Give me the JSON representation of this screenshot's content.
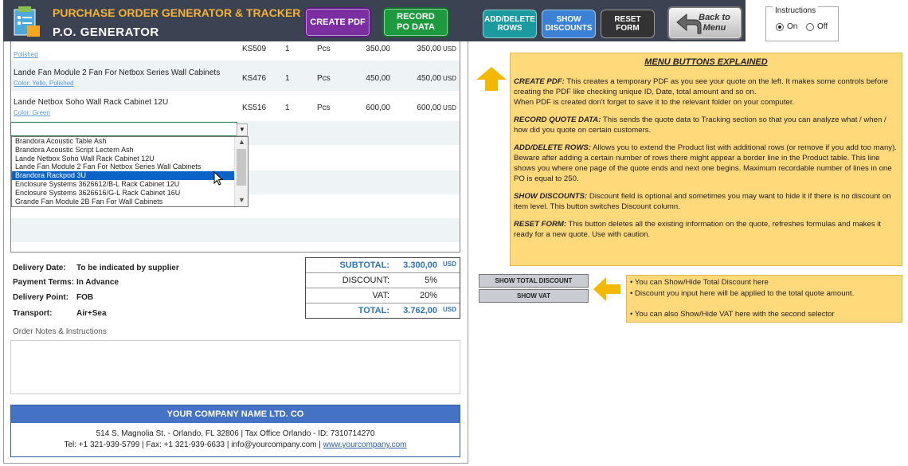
{
  "header": {
    "title": "PURCHASE ORDER GENERATOR & TRACKER",
    "subtitle": "P.O. GENERATOR",
    "buttons": {
      "create_pdf": "CREATE PDF",
      "record": "RECORD PO DATA",
      "add_delete": "ADD/DELETE ROWS",
      "show_discounts": "SHOW DISCOUNTS",
      "reset": "RESET FORM",
      "back": "Back to Menu"
    }
  },
  "instructions": {
    "title": "Instructions",
    "on": "On",
    "off": "Off",
    "selected": "On"
  },
  "products": [
    {
      "name": "",
      "color": "Polished",
      "code": "KS509",
      "qty": "1",
      "unit": "Pcs",
      "price": "350,00",
      "total": "350,00",
      "currency": "USD"
    },
    {
      "name": "Lande Fan Module 2 Fan For Netbox Series Wall Cabinets",
      "color": "Color: Yello, Polished",
      "code": "KS476",
      "qty": "1",
      "unit": "Pcs",
      "price": "450,00",
      "total": "450,00",
      "currency": "USD"
    },
    {
      "name": "Lande Netbox Soho Wall Rack Cabinet 12U",
      "color": "Color: Green",
      "code": "KS516",
      "qty": "1",
      "unit": "Pcs",
      "price": "600,00",
      "total": "600,00",
      "currency": "USD"
    }
  ],
  "dropdown": {
    "items": [
      "Brandora Acoustic Table Ash",
      "Brandora Acoustic Script Lectern Ash",
      "Lande Netbox Soho Wall Rack Cabinet 12U",
      "Lande Fan Module 2 Fan For Netbox Series Wall Cabinets",
      "Brandora Rackpod 3U",
      "Enclosure Systems 3626612/B-L Rack Cabinet 12U",
      "Enclosure Systems 3626616/G-L Rack Cabinet 16U",
      "Grande Fan Module 2B Fan For Wall Cabinets"
    ],
    "selected": "Brandora Rackpod 3U"
  },
  "terms": [
    {
      "label": "Delivery Date:",
      "value": "To be indicated by supplier"
    },
    {
      "label": "Payment Terms:",
      "value": "In Advance"
    },
    {
      "label": "Delivery Point:",
      "value": "FOB"
    },
    {
      "label": "Transport:",
      "value": "Air+Sea"
    }
  ],
  "totals": {
    "subtotal_label": "SUBTOTAL:",
    "subtotal": "3.300,00",
    "subtotal_cur": "USD",
    "discount_label": "DISCOUNT:",
    "discount": "5%",
    "vat_label": "VAT:",
    "vat": "20%",
    "total_label": "TOTAL:",
    "total": "3.762,00",
    "total_cur": "USD"
  },
  "notes_label": "Order Notes & Instructions",
  "footer": {
    "company": "YOUR COMPANY NAME LTD. CO",
    "address": "514 S. Magnolia St. - Orlando, FL 32806  |  Tax Office Orlando - ID: 7310714270",
    "tel": "Tel: +1 321-939-5799  |  Fax: +1 321-939-6633  |  info@yourcompany.com  |",
    "web": "www.yourcompany.com"
  },
  "menu": {
    "heading": "MENU BUTTONS EXPLAINED",
    "create_pdf_k": "CREATE PDF:",
    "create_pdf_t": " This creates a temporary PDF as you see your quote on the left. It makes some controls before creating the PDF like checking unique ID, Date, total amount and so on.",
    "create_pdf_t2": "When PDF is created don't forget to save it to the relevant folder on your computer.",
    "record_k": "RECORD QUOTE DATA:",
    "record_t": " This sends the quote data to Tracking section so that you can analyze what / when / how did you quote on certain customers.",
    "add_k": "ADD/DELETE ROWS:",
    "add_t": " Allows you to extend the Product list with additional rows (or remove if you add too many). Beware after adding a certain number of rows there might appear a border line in the Product table. This line shows you where one page of the quote ends and next one begins. Maximum recordable number of lines in one PO is equal to 250.",
    "disc_k": "SHOW DISCOUNTS:",
    "disc_t": " Discount field is optional and sometimes you may want to hide it if there is no discount on item level. This button switches Discount column.",
    "reset_k": "RESET FORM:",
    "reset_t": " This button deletes all the existing information on the quote, refreshes formulas and makes it ready for a new quote. Use with caution."
  },
  "side_buttons": {
    "total_discount": "SHOW TOTAL DISCOUNT",
    "vat": "SHOW VAT"
  },
  "side_notes": [
    "You can Show/Hide Total Discount here",
    "Discount you input here will be applied to the total quote amount.",
    "You can also Show/Hide VAT here with the second selector"
  ]
}
